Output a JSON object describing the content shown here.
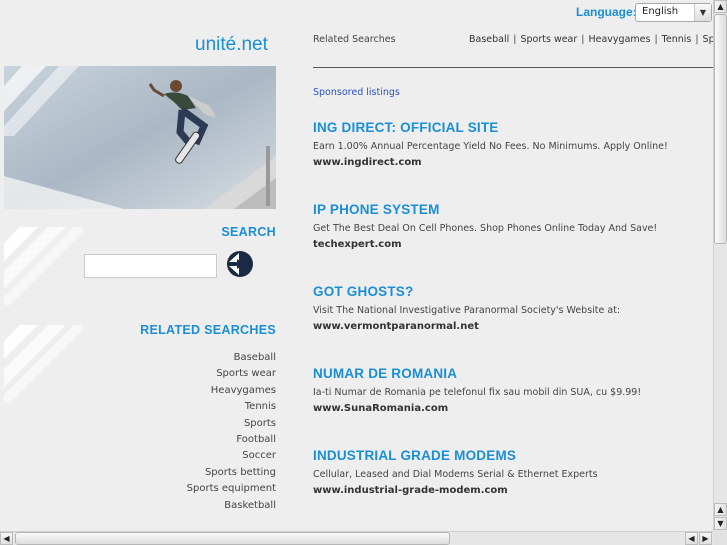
{
  "site": {
    "logo": "unité.net"
  },
  "language": {
    "label": "Language:",
    "selected": "English"
  },
  "topbar": {
    "label": "Related Searches",
    "links": [
      "Baseball",
      "Sports wear",
      "Heavygames",
      "Tennis",
      "Sports"
    ]
  },
  "sponsored_label": "Sponsored listings",
  "search": {
    "title": "SEARCH",
    "value": ""
  },
  "related": {
    "title": "RELATED SEARCHES",
    "items": [
      "Baseball",
      "Sports wear",
      "Heavygames",
      "Tennis",
      "Sports",
      "Football",
      "Soccer",
      "Sports betting",
      "Sports equipment",
      "Basketball"
    ]
  },
  "listings": [
    {
      "title": "ING DIRECT: OFFICIAL SITE",
      "desc": "Earn 1.00% Annual Percentage Yield No Fees. No Minimums. Apply Online!",
      "url": "www.ingdirect.com"
    },
    {
      "title": "IP PHONE SYSTEM",
      "desc": "Get The Best Deal On Cell Phones. Shop Phones Online Today And Save!",
      "url": "techexpert.com"
    },
    {
      "title": "GOT GHOSTS?",
      "desc": "Visit The National Investigative Paranormal Society's Website at:",
      "url": "www.vermontparanormal.net"
    },
    {
      "title": "NUMAR DE ROMANIA",
      "desc": "Ia-ti Numar de Romania pe telefonul fix sau mobil din SUA, cu $9.99!",
      "url": "www.SunaRomania.com"
    },
    {
      "title": "INDUSTRIAL GRADE MODEMS",
      "desc": "Cellular, Leased and Dial Modems Serial & Ethernet Experts",
      "url": "www.industrial-grade-modem.com"
    }
  ],
  "colors": {
    "accent": "#1a8fd6",
    "sponsored": "#2a52c4",
    "background": "#eeeeee"
  },
  "icons": {
    "search_button": "double-arrow-right-icon",
    "dropdown": "chevron-down-icon"
  }
}
